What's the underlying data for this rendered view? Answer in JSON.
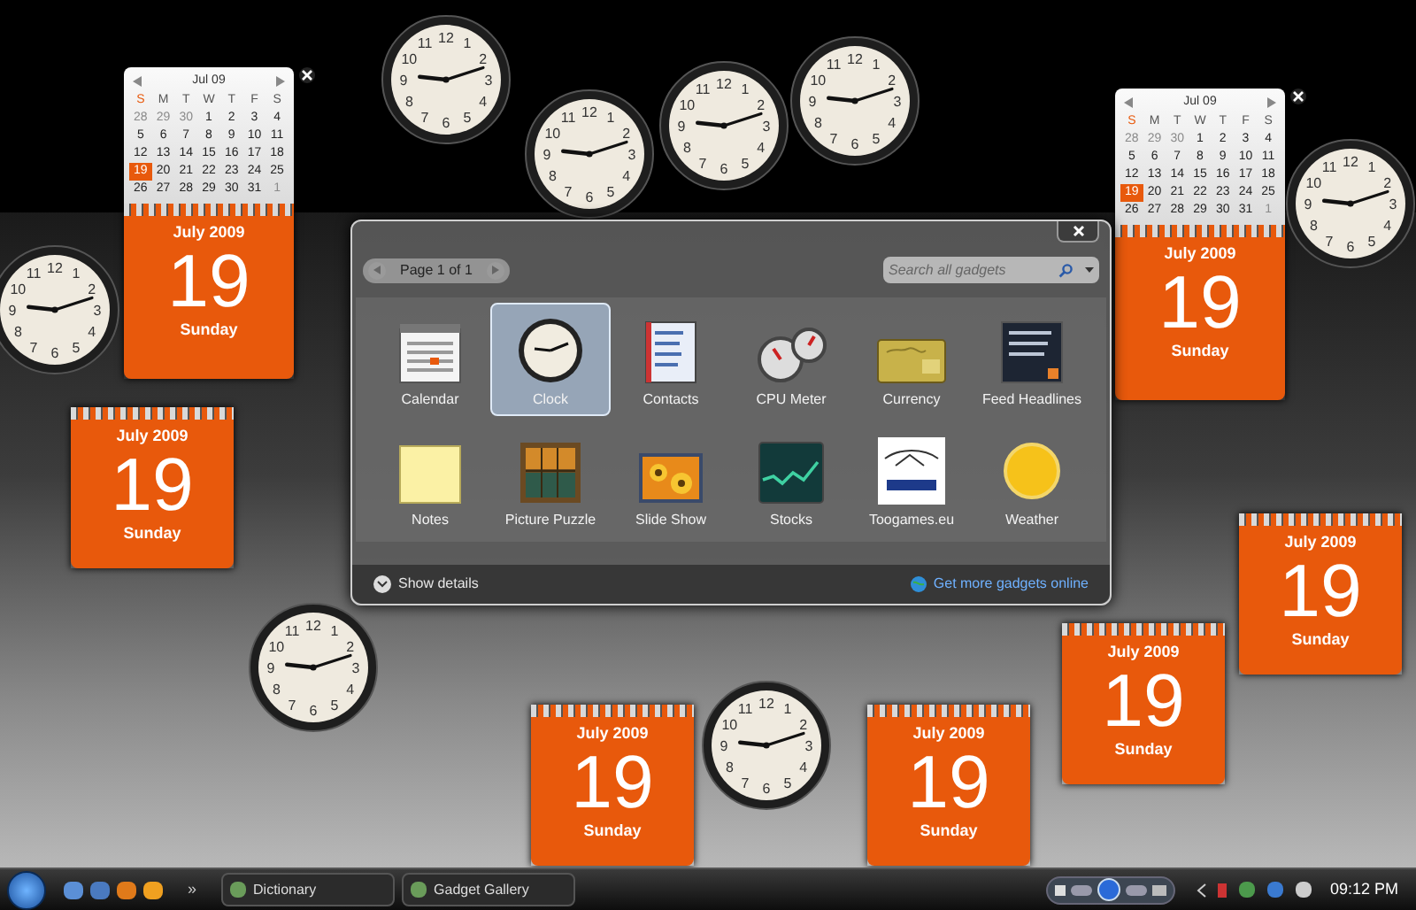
{
  "calendars": [
    {
      "month": "Jul 09",
      "weekdays": [
        "S",
        "M",
        "T",
        "W",
        "T",
        "F",
        "S"
      ],
      "title": "July 2009",
      "day": "19",
      "weekday": "Sunday",
      "days": [
        {
          "d": "28",
          "dim": true,
          "selected": false
        },
        {
          "d": "29",
          "dim": true,
          "selected": false
        },
        {
          "d": "30",
          "dim": true,
          "selected": false
        },
        {
          "d": "1",
          "dim": false,
          "selected": false
        },
        {
          "d": "2",
          "dim": false,
          "selected": false
        },
        {
          "d": "3",
          "dim": false,
          "selected": false
        },
        {
          "d": "4",
          "dim": false,
          "selected": false
        },
        {
          "d": "5",
          "dim": false,
          "selected": false
        },
        {
          "d": "6",
          "dim": false,
          "selected": false
        },
        {
          "d": "7",
          "dim": false,
          "selected": false
        },
        {
          "d": "8",
          "dim": false,
          "selected": false
        },
        {
          "d": "9",
          "dim": false,
          "selected": false
        },
        {
          "d": "10",
          "dim": false,
          "selected": false
        },
        {
          "d": "11",
          "dim": false,
          "selected": false
        },
        {
          "d": "12",
          "dim": false,
          "selected": false
        },
        {
          "d": "13",
          "dim": false,
          "selected": false
        },
        {
          "d": "14",
          "dim": false,
          "selected": false
        },
        {
          "d": "15",
          "dim": false,
          "selected": false
        },
        {
          "d": "16",
          "dim": false,
          "selected": false
        },
        {
          "d": "17",
          "dim": false,
          "selected": false
        },
        {
          "d": "18",
          "dim": false,
          "selected": false
        },
        {
          "d": "19",
          "dim": false,
          "selected": true
        },
        {
          "d": "20",
          "dim": false,
          "selected": false
        },
        {
          "d": "21",
          "dim": false,
          "selected": false
        },
        {
          "d": "22",
          "dim": false,
          "selected": false
        },
        {
          "d": "23",
          "dim": false,
          "selected": false
        },
        {
          "d": "24",
          "dim": false,
          "selected": false
        },
        {
          "d": "25",
          "dim": false,
          "selected": false
        },
        {
          "d": "26",
          "dim": false,
          "selected": false
        },
        {
          "d": "27",
          "dim": false,
          "selected": false
        },
        {
          "d": "28",
          "dim": false,
          "selected": false
        },
        {
          "d": "29",
          "dim": false,
          "selected": false
        },
        {
          "d": "30",
          "dim": false,
          "selected": false
        },
        {
          "d": "31",
          "dim": false,
          "selected": false
        },
        {
          "d": "1",
          "dim": true,
          "selected": false
        }
      ]
    },
    {
      "month": "Jul 09",
      "weekdays": [
        "S",
        "M",
        "T",
        "W",
        "T",
        "F",
        "S"
      ],
      "title": "July 2009",
      "day": "19",
      "weekday": "Sunday",
      "days": [
        {
          "d": "28",
          "dim": true,
          "selected": false
        },
        {
          "d": "29",
          "dim": true,
          "selected": false
        },
        {
          "d": "30",
          "dim": true,
          "selected": false
        },
        {
          "d": "1",
          "dim": false,
          "selected": false
        },
        {
          "d": "2",
          "dim": false,
          "selected": false
        },
        {
          "d": "3",
          "dim": false,
          "selected": false
        },
        {
          "d": "4",
          "dim": false,
          "selected": false
        },
        {
          "d": "5",
          "dim": false,
          "selected": false
        },
        {
          "d": "6",
          "dim": false,
          "selected": false
        },
        {
          "d": "7",
          "dim": false,
          "selected": false
        },
        {
          "d": "8",
          "dim": false,
          "selected": false
        },
        {
          "d": "9",
          "dim": false,
          "selected": false
        },
        {
          "d": "10",
          "dim": false,
          "selected": false
        },
        {
          "d": "11",
          "dim": false,
          "selected": false
        },
        {
          "d": "12",
          "dim": false,
          "selected": false
        },
        {
          "d": "13",
          "dim": false,
          "selected": false
        },
        {
          "d": "14",
          "dim": false,
          "selected": false
        },
        {
          "d": "15",
          "dim": false,
          "selected": false
        },
        {
          "d": "16",
          "dim": false,
          "selected": false
        },
        {
          "d": "17",
          "dim": false,
          "selected": false
        },
        {
          "d": "18",
          "dim": false,
          "selected": false
        },
        {
          "d": "19",
          "dim": false,
          "selected": true
        },
        {
          "d": "20",
          "dim": false,
          "selected": false
        },
        {
          "d": "21",
          "dim": false,
          "selected": false
        },
        {
          "d": "22",
          "dim": false,
          "selected": false
        },
        {
          "d": "23",
          "dim": false,
          "selected": false
        },
        {
          "d": "24",
          "dim": false,
          "selected": false
        },
        {
          "d": "25",
          "dim": false,
          "selected": false
        },
        {
          "d": "26",
          "dim": false,
          "selected": false
        },
        {
          "d": "27",
          "dim": false,
          "selected": false
        },
        {
          "d": "28",
          "dim": false,
          "selected": false
        },
        {
          "d": "29",
          "dim": false,
          "selected": false
        },
        {
          "d": "30",
          "dim": false,
          "selected": false
        },
        {
          "d": "31",
          "dim": false,
          "selected": false
        },
        {
          "d": "1",
          "dim": true,
          "selected": false
        }
      ]
    }
  ],
  "day_cards": [
    {
      "title": "July 2009",
      "day": "19",
      "weekday": "Sunday"
    },
    {
      "title": "July 2009",
      "day": "19",
      "weekday": "Sunday"
    },
    {
      "title": "July 2009",
      "day": "19",
      "weekday": "Sunday"
    },
    {
      "title": "July 2009",
      "day": "19",
      "weekday": "Sunday"
    },
    {
      "title": "July 2009",
      "day": "19",
      "weekday": "Sunday"
    }
  ],
  "clocks": [
    {
      "numerals": [
        "12",
        "11",
        "1",
        "10",
        "2",
        "9",
        "3",
        "8",
        "4",
        "7",
        "5",
        "6"
      ]
    },
    {
      "numerals": [
        "12",
        "11",
        "1",
        "10",
        "2",
        "9",
        "3",
        "8",
        "4",
        "7",
        "5",
        "6"
      ]
    },
    {
      "numerals": [
        "12",
        "11",
        "1",
        "10",
        "2",
        "9",
        "3",
        "8",
        "4",
        "7",
        "5",
        "6"
      ]
    },
    {
      "numerals": [
        "12",
        "11",
        "1",
        "10",
        "2",
        "9",
        "3",
        "8",
        "4",
        "7",
        "5",
        "6"
      ]
    },
    {
      "numerals": [
        "12",
        "11",
        "1",
        "10",
        "2",
        "9",
        "3",
        "8",
        "4",
        "7",
        "5",
        "6"
      ]
    },
    {
      "numerals": [
        "12",
        "11",
        "1",
        "10",
        "2",
        "9",
        "3",
        "8",
        "4",
        "7",
        "5",
        "6"
      ]
    },
    {
      "numerals": [
        "12",
        "11",
        "1",
        "10",
        "2",
        "9",
        "3",
        "8",
        "4",
        "7",
        "5",
        "6"
      ]
    },
    {
      "numerals": [
        "12",
        "11",
        "1",
        "10",
        "2",
        "9",
        "3",
        "8",
        "4",
        "7",
        "5",
        "6"
      ]
    }
  ],
  "gallery": {
    "pager": "Page 1 of 1",
    "search": {
      "placeholder": "Search all gadgets"
    },
    "gadgets": [
      {
        "label": "Calendar",
        "kind": "calendar",
        "selected": false
      },
      {
        "label": "Clock",
        "kind": "clock",
        "selected": true
      },
      {
        "label": "Contacts",
        "kind": "contacts",
        "selected": false
      },
      {
        "label": "CPU Meter",
        "kind": "meter",
        "selected": false
      },
      {
        "label": "Currency",
        "kind": "currency",
        "selected": false
      },
      {
        "label": "Feed Headlines",
        "kind": "feed",
        "selected": false
      },
      {
        "label": "Notes",
        "kind": "notes",
        "selected": false
      },
      {
        "label": "Picture Puzzle",
        "kind": "puzzle",
        "selected": false
      },
      {
        "label": "Slide Show",
        "kind": "slideshow",
        "selected": false
      },
      {
        "label": "Stocks",
        "kind": "stocks",
        "selected": false
      },
      {
        "label": "Toogames.eu",
        "kind": "logo",
        "selected": false
      },
      {
        "label": "Weather",
        "kind": "weather",
        "selected": false
      }
    ],
    "details": "Show details",
    "online_link": "Get more gadgets online"
  },
  "taskbar": {
    "more": "»",
    "tasks": [
      {
        "label": "Dictionary",
        "selected": false
      },
      {
        "label": "Gadget Gallery",
        "selected": false
      }
    ],
    "time": "09:12 PM"
  }
}
